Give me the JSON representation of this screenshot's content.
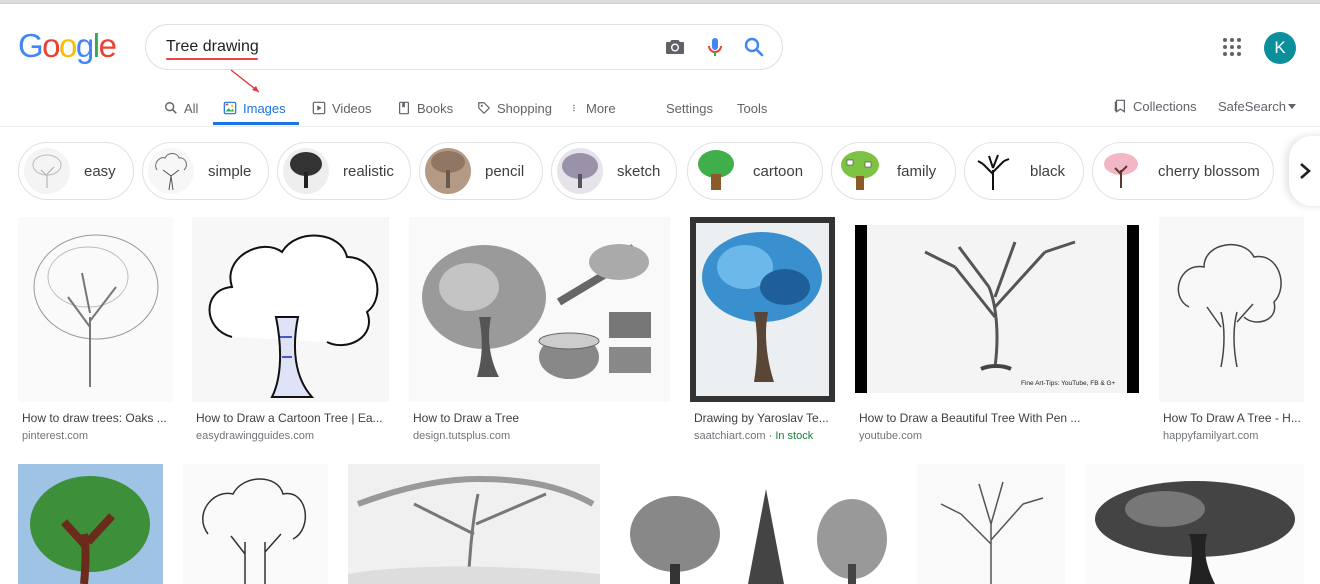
{
  "logo": {
    "letters": [
      "G",
      "o",
      "o",
      "g",
      "l",
      "e"
    ],
    "colors": [
      "#4285f4",
      "#ea4335",
      "#fbbc05",
      "#4285f4",
      "#34a853",
      "#ea4335"
    ]
  },
  "search": {
    "query": "Tree drawing",
    "camera_icon": "camera-icon",
    "mic_icon": "mic-icon",
    "search_icon": "search-icon"
  },
  "tabs": [
    {
      "label": "All",
      "icon": "search-icon"
    },
    {
      "label": "Images",
      "icon": "image-icon",
      "active": true
    },
    {
      "label": "Videos",
      "icon": "video-icon"
    },
    {
      "label": "Books",
      "icon": "book-icon"
    },
    {
      "label": "Shopping",
      "icon": "tag-icon"
    },
    {
      "label": "More",
      "icon": "more-vert-icon"
    },
    {
      "label": "Settings"
    },
    {
      "label": "Tools"
    }
  ],
  "right_tools": {
    "collections": "Collections",
    "safesearch": "SafeSearch"
  },
  "account": {
    "avatar_letter": "K",
    "avatar_color": "#0b8f9b"
  },
  "chips": [
    "easy",
    "simple",
    "realistic",
    "pencil",
    "sketch",
    "cartoon",
    "family",
    "black",
    "cherry blossom"
  ],
  "results": [
    {
      "title": "How to draw trees: Oaks ...",
      "source": "pinterest.com"
    },
    {
      "title": "How to Draw a Cartoon Tree | Ea...",
      "source": "easydrawingguides.com"
    },
    {
      "title": "How to Draw a Tree",
      "source": "design.tutsplus.com"
    },
    {
      "title": "Drawing by Yaroslav Te...",
      "source": "saatchiart.com",
      "extra": "· In stock"
    },
    {
      "title": "How to Draw a Beautiful Tree With Pen ...",
      "source": "youtube.com",
      "watermark": "Fine Art-Tips: YouTube, FB & G+"
    },
    {
      "title": "How To Draw A Tree - H...",
      "source": "happyfamilyart.com"
    }
  ],
  "colors": {
    "accent": "#1a73e8",
    "in_stock": "#188038",
    "text_muted": "#5f6368"
  }
}
